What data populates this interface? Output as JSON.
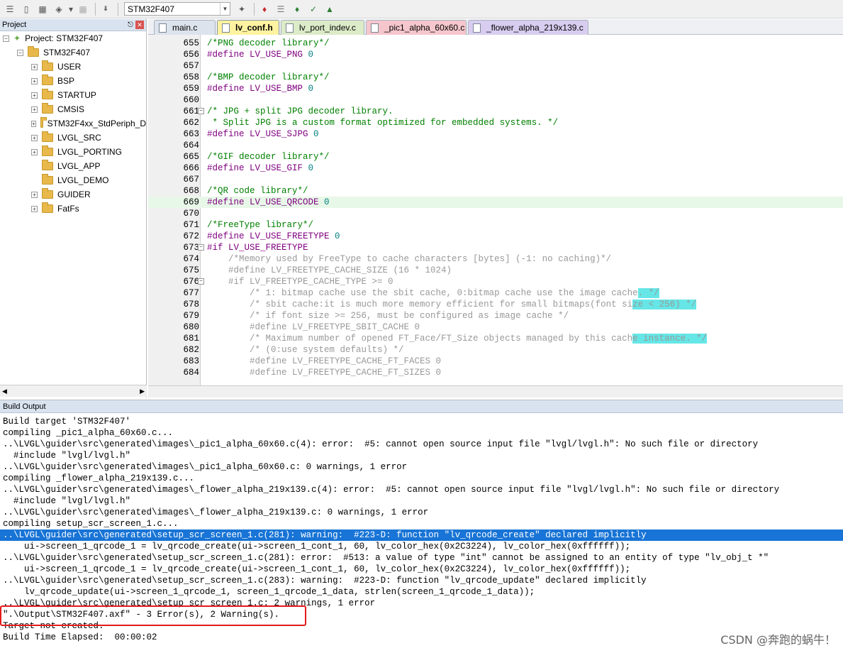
{
  "toolbar": {
    "target": "STM32F407",
    "icons": [
      "stack-icon",
      "page-icon",
      "grid-icon",
      "layers-icon",
      "dropdown-chevron-icon",
      "disabled-icon",
      "load-icon",
      "magic-wand-icon",
      "red-diamond-icon",
      "stack-gray-icon",
      "green-diamond-icon",
      "green-check-icon",
      "green-triangle-icon"
    ]
  },
  "project": {
    "title": "Project",
    "tree": [
      {
        "label": "Project: STM32F407",
        "level": 0,
        "toggle": "−",
        "icon": "project-icon"
      },
      {
        "label": "STM32F407",
        "level": 1,
        "toggle": "−",
        "icon": "target-icon"
      },
      {
        "label": "USER",
        "level": 2,
        "toggle": "+"
      },
      {
        "label": "BSP",
        "level": 2,
        "toggle": "+"
      },
      {
        "label": "STARTUP",
        "level": 2,
        "toggle": "+"
      },
      {
        "label": "CMSIS",
        "level": 2,
        "toggle": "+"
      },
      {
        "label": "STM32F4xx_StdPeriph_D",
        "level": 2,
        "toggle": "+"
      },
      {
        "label": "LVGL_SRC",
        "level": 2,
        "toggle": "+"
      },
      {
        "label": "LVGL_PORTING",
        "level": 2,
        "toggle": "+"
      },
      {
        "label": "LVGL_APP",
        "level": 2,
        "toggle": ""
      },
      {
        "label": "LVGL_DEMO",
        "level": 2,
        "toggle": ""
      },
      {
        "label": "GUIDER",
        "level": 2,
        "toggle": "+"
      },
      {
        "label": "FatFs",
        "level": 2,
        "toggle": "+"
      }
    ]
  },
  "tabs": [
    {
      "label": "main.c",
      "active": false,
      "color": "#dde3ec"
    },
    {
      "label": "lv_conf.h",
      "active": true,
      "color": "#fff2a0"
    },
    {
      "label": "lv_port_indev.c",
      "active": false,
      "color": "#dcebc8"
    },
    {
      "label": "_pic1_alpha_60x60.c",
      "active": false,
      "color": "#f5c6cc"
    },
    {
      "label": "_flower_alpha_219x139.c",
      "active": false,
      "color": "#d8cdf0"
    }
  ],
  "editor": {
    "lines": [
      {
        "n": "655",
        "t": "/*PNG decoder library*/",
        "c": "cm"
      },
      {
        "n": "656",
        "t": "#define LV_USE_PNG ",
        "c": "pp",
        "v": "0"
      },
      {
        "n": "657",
        "t": "",
        "c": ""
      },
      {
        "n": "658",
        "t": "/*BMP decoder library*/",
        "c": "cm"
      },
      {
        "n": "659",
        "t": "#define LV_USE_BMP ",
        "c": "pp",
        "v": "0"
      },
      {
        "n": "660",
        "t": "",
        "c": ""
      },
      {
        "n": "661",
        "t": "/* JPG + split JPG decoder library.",
        "c": "cm",
        "fold": "−"
      },
      {
        "n": "662",
        "t": " * Split JPG is a custom format optimized for embedded systems. */",
        "c": "cm"
      },
      {
        "n": "663",
        "t": "#define LV_USE_SJPG ",
        "c": "pp",
        "v": "0"
      },
      {
        "n": "664",
        "t": "",
        "c": ""
      },
      {
        "n": "665",
        "t": "/*GIF decoder library*/",
        "c": "cm"
      },
      {
        "n": "666",
        "t": "#define LV_USE_GIF ",
        "c": "pp",
        "v": "0"
      },
      {
        "n": "667",
        "t": "",
        "c": ""
      },
      {
        "n": "668",
        "t": "/*QR code library*/",
        "c": "cm"
      },
      {
        "n": "669",
        "t": "#define LV_USE_QRCODE ",
        "c": "pp",
        "v": "0",
        "cur": true
      },
      {
        "n": "670",
        "t": "",
        "c": ""
      },
      {
        "n": "671",
        "t": "/*FreeType library*/",
        "c": "cm"
      },
      {
        "n": "672",
        "t": "#define LV_USE_FREETYPE ",
        "c": "pp",
        "v": "0"
      },
      {
        "n": "673",
        "t": "#if LV_USE_FREETYPE",
        "c": "pp",
        "fold": "−"
      },
      {
        "n": "674",
        "t": "    /*Memory used by FreeType to cache characters [bytes] (-1: no caching)*/",
        "c": "gray"
      },
      {
        "n": "675",
        "t": "    #define LV_FREETYPE_CACHE_SIZE (16 * 1024)",
        "c": "gray"
      },
      {
        "n": "676",
        "t": "    #if LV_FREETYPE_CACHE_TYPE >= 0",
        "c": "gray",
        "fold": "−"
      },
      {
        "n": "677",
        "t": "        /* 1: bitmap cache use the sbit cache, 0:bitmap cache use the image cache",
        "c": "gray",
        "hl": ". */"
      },
      {
        "n": "678",
        "t": "        /* sbit cache:it is much more memory efficient for small bitmaps(font si",
        "c": "gray",
        "hl": "ze < 256) */"
      },
      {
        "n": "679",
        "t": "        /* if font size >= 256, must be configured as image cache */",
        "c": "gray"
      },
      {
        "n": "680",
        "t": "        #define LV_FREETYPE_SBIT_CACHE 0",
        "c": "gray"
      },
      {
        "n": "681",
        "t": "        /* Maximum number of opened FT_Face/FT_Size objects managed by this cach",
        "c": "gray",
        "hl": "e instance. */"
      },
      {
        "n": "682",
        "t": "        /* (0:use system defaults) */",
        "c": "gray"
      },
      {
        "n": "683",
        "t": "        #define LV_FREETYPE_CACHE_FT_FACES 0",
        "c": "gray"
      },
      {
        "n": "684",
        "t": "        #define LV_FREETYPE_CACHE_FT_SIZES 0",
        "c": "gray"
      }
    ]
  },
  "build": {
    "title": "Build Output",
    "lines": [
      "Build target 'STM32F407'",
      "compiling _pic1_alpha_60x60.c...",
      "..\\LVGL\\guider\\src\\generated\\images\\_pic1_alpha_60x60.c(4): error:  #5: cannot open source input file \"lvgl/lvgl.h\": No such file or directory",
      "  #include \"lvgl/lvgl.h\"",
      "..\\LVGL\\guider\\src\\generated\\images\\_pic1_alpha_60x60.c: 0 warnings, 1 error",
      "compiling _flower_alpha_219x139.c...",
      "..\\LVGL\\guider\\src\\generated\\images\\_flower_alpha_219x139.c(4): error:  #5: cannot open source input file \"lvgl/lvgl.h\": No such file or directory",
      "  #include \"lvgl/lvgl.h\"",
      "..\\LVGL\\guider\\src\\generated\\images\\_flower_alpha_219x139.c: 0 warnings, 1 error",
      "compiling setup_scr_screen_1.c...",
      "..\\LVGL\\guider\\src\\generated\\setup_scr_screen_1.c(281): warning:  #223-D: function \"lv_qrcode_create\" declared implicitly",
      "    ui->screen_1_qrcode_1 = lv_qrcode_create(ui->screen_1_cont_1, 60, lv_color_hex(0x2C3224), lv_color_hex(0xffffff));",
      "..\\LVGL\\guider\\src\\generated\\setup_scr_screen_1.c(281): error:  #513: a value of type \"int\" cannot be assigned to an entity of type \"lv_obj_t *\"",
      "    ui->screen_1_qrcode_1 = lv_qrcode_create(ui->screen_1_cont_1, 60, lv_color_hex(0x2C3224), lv_color_hex(0xffffff));",
      "..\\LVGL\\guider\\src\\generated\\setup_scr_screen_1.c(283): warning:  #223-D: function \"lv_qrcode_update\" declared implicitly",
      "    lv_qrcode_update(ui->screen_1_qrcode_1, screen_1_qrcode_1_data, strlen(screen_1_qrcode_1_data));",
      "..\\LVGL\\guider\\src\\generated\\setup_scr_screen_1.c: 2 warnings, 1 error",
      "\".\\Output\\STM32F407.axf\" - 3 Error(s), 2 Warning(s).",
      "Target not created.",
      "Build Time Elapsed:  00:00:02"
    ],
    "selected_index": 10
  },
  "watermark": "CSDN @奔跑的蜗牛！"
}
